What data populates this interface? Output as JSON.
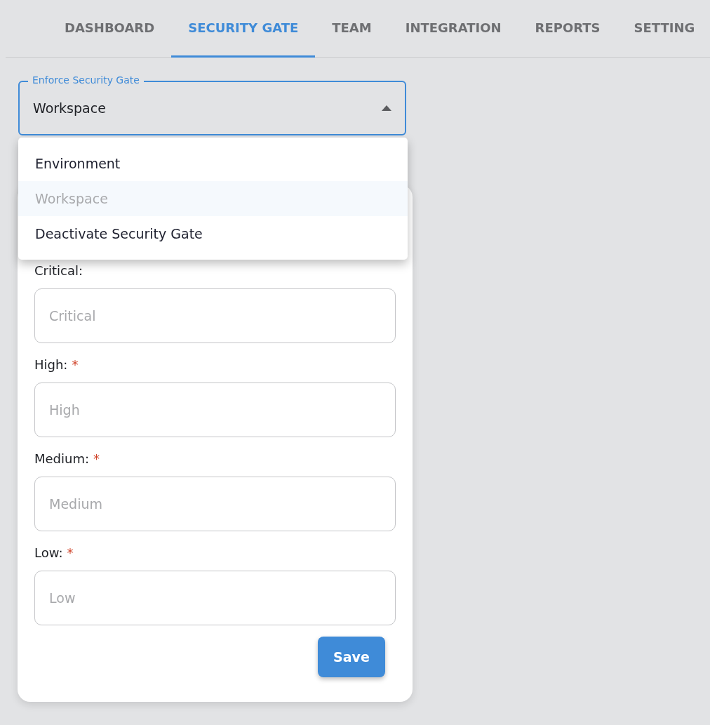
{
  "tabs": [
    {
      "label": "DASHBOARD",
      "selected": false
    },
    {
      "label": "SECURITY GATE",
      "selected": true
    },
    {
      "label": "TEAM",
      "selected": false
    },
    {
      "label": "INTEGRATION",
      "selected": false
    },
    {
      "label": "REPORTS",
      "selected": false
    },
    {
      "label": "SETTING",
      "selected": false
    }
  ],
  "select": {
    "label": "Enforce Security Gate",
    "value": "Workspace",
    "expanded": true,
    "options": [
      {
        "label": "Environment",
        "selected": false
      },
      {
        "label": "Workspace",
        "selected": true
      },
      {
        "label": "Deactivate Security Gate",
        "selected": false
      }
    ]
  },
  "fields": [
    {
      "label": "Critical:",
      "placeholder": "Critical"
    },
    {
      "label": "High:",
      "required_mark": "*",
      "placeholder": "High"
    },
    {
      "label": "Medium:",
      "required_mark": "*",
      "placeholder": "Medium"
    },
    {
      "label": "Low:",
      "required_mark": "*",
      "placeholder": "Low"
    }
  ],
  "save_button": "Save"
}
